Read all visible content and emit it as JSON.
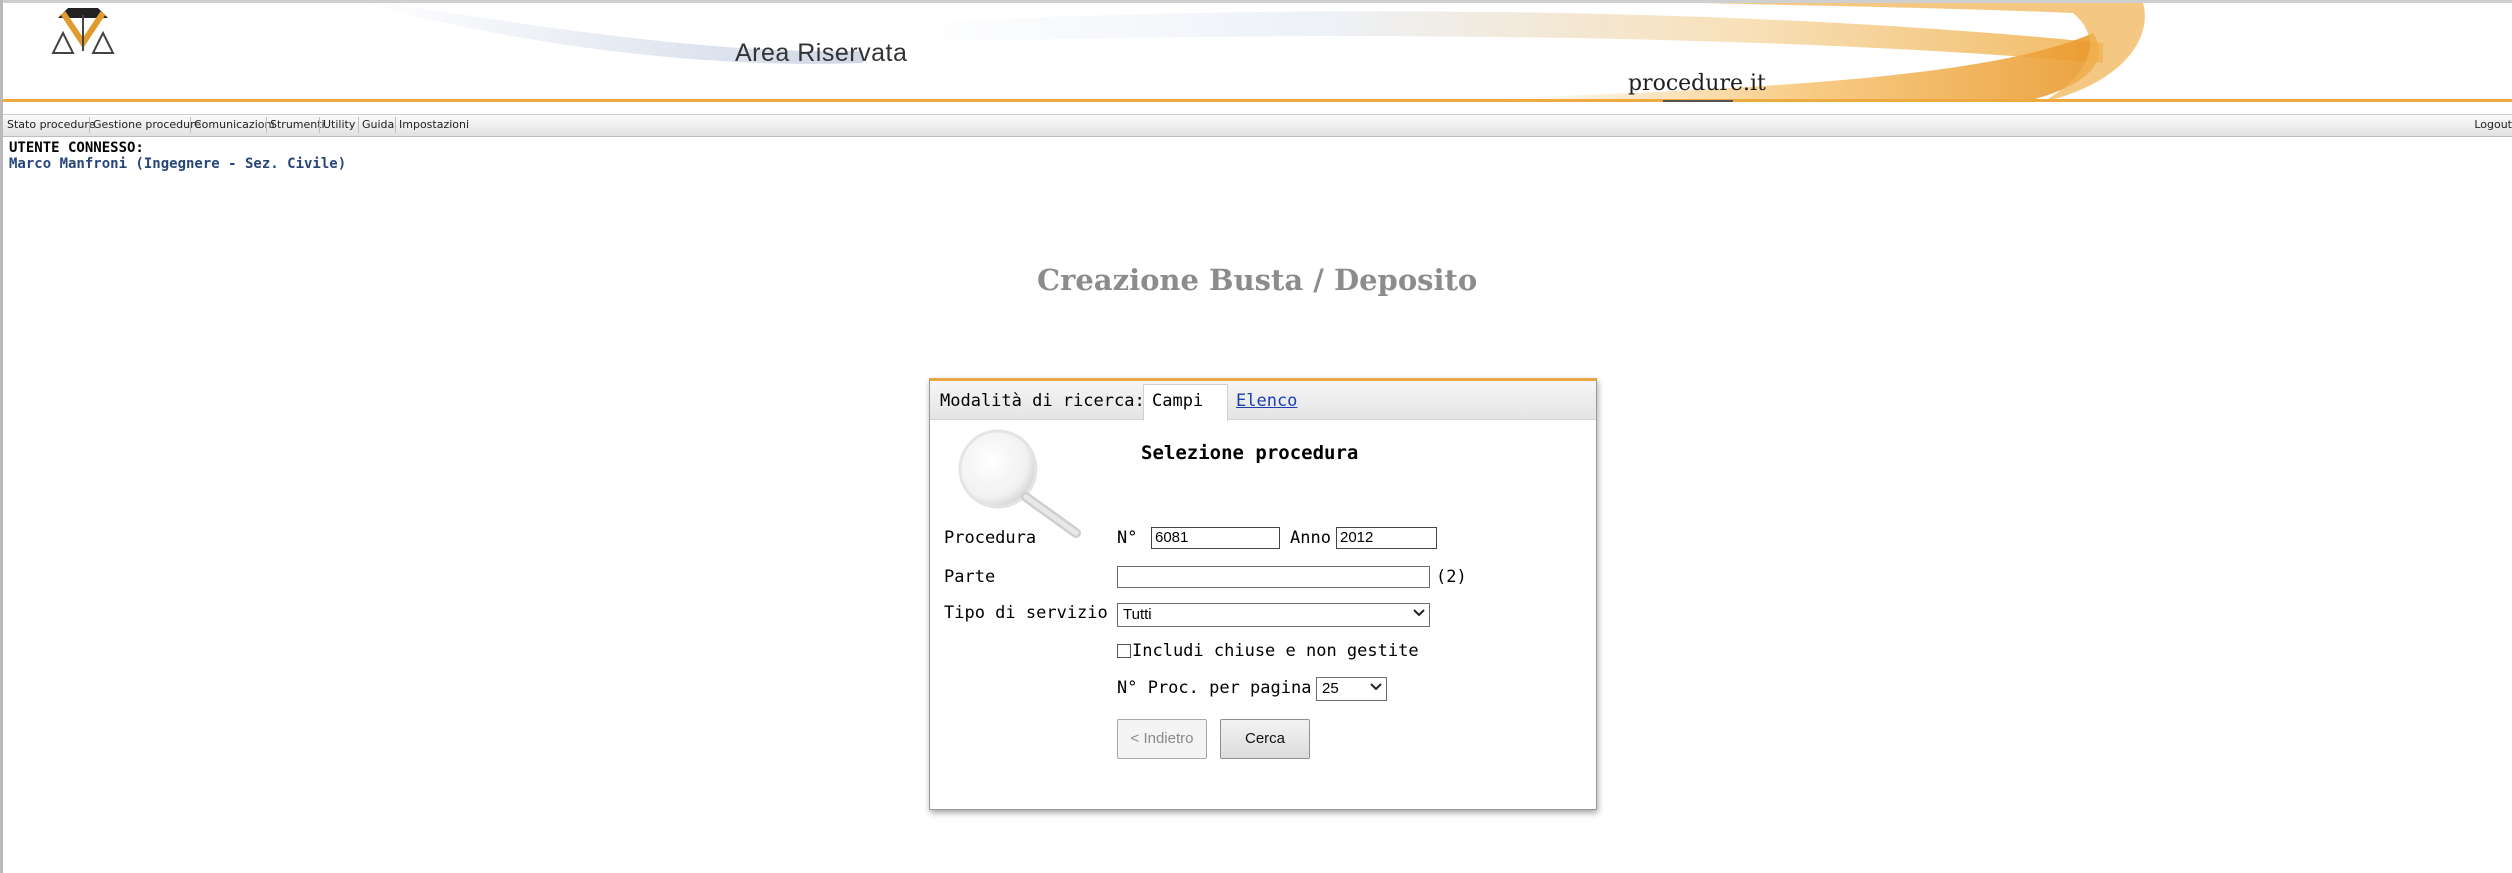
{
  "header": {
    "area_title": "Area Riservata",
    "logo_text": "procedure.it"
  },
  "menu": {
    "items": [
      {
        "label": "Stato procedure"
      },
      {
        "label": "Gestione procedure"
      },
      {
        "label": "Comunicazioni"
      },
      {
        "label": "Strumenti"
      },
      {
        "label": "Utility"
      },
      {
        "label": "Guida"
      },
      {
        "label": "Impostazioni"
      }
    ],
    "logout": "Logout"
  },
  "user": {
    "label": "UTENTE CONNESSO:",
    "name": "Marco Manfroni (Ingegnere - Sez. Civile)"
  },
  "page_title": "Creazione Busta / Deposito",
  "dialog": {
    "tabs": {
      "lead": "Modalità di ricerca:",
      "active": "Campi",
      "link": "Elenco"
    },
    "section_title": "Selezione procedura",
    "procedura": {
      "label": "Procedura",
      "num_prefix": "N°",
      "num_value": "6081",
      "anno_label": "Anno",
      "anno_value": "2012"
    },
    "parte": {
      "label": "Parte",
      "value": "",
      "hint": "(2)"
    },
    "tipo_servizio": {
      "label": "Tipo di servizio",
      "selected": "Tutti"
    },
    "includi_chiuse": {
      "label": "Includi chiuse e non gestite",
      "checked": false
    },
    "per_pagina": {
      "label": "N° Proc. per pagina",
      "selected": "25"
    },
    "buttons": {
      "back": "< Indietro",
      "search": "Cerca"
    }
  },
  "colors": {
    "accent": "#e8a741",
    "user_name": "#27457a",
    "link": "#1a3fb0",
    "title": "#8c8c8c"
  }
}
